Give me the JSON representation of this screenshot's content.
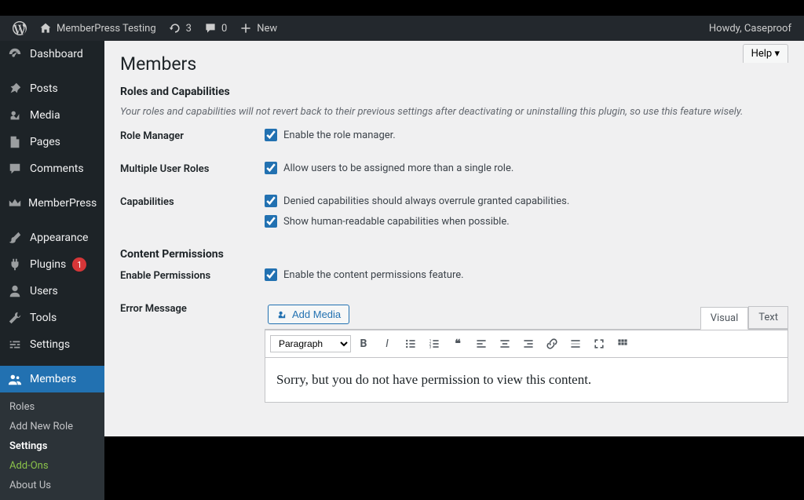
{
  "adminbar": {
    "site_title": "MemberPress Testing",
    "updates": "3",
    "comments": "0",
    "new": "New",
    "howdy": "Howdy, Caseproof"
  },
  "sidebar": {
    "items": [
      {
        "label": "Dashboard"
      },
      {
        "label": "Posts"
      },
      {
        "label": "Media"
      },
      {
        "label": "Pages"
      },
      {
        "label": "Comments"
      },
      {
        "label": "MemberPress"
      },
      {
        "label": "Appearance"
      },
      {
        "label": "Plugins",
        "badge": "1"
      },
      {
        "label": "Users"
      },
      {
        "label": "Tools"
      },
      {
        "label": "Settings"
      },
      {
        "label": "Members"
      }
    ],
    "submenu": [
      {
        "label": "Roles"
      },
      {
        "label": "Add New Role"
      },
      {
        "label": "Settings"
      },
      {
        "label": "Add-Ons"
      },
      {
        "label": "About Us"
      }
    ]
  },
  "page": {
    "help": "Help",
    "title": "Members",
    "section1_title": "Roles and Capabilities",
    "section1_desc": "Your roles and capabilities will not revert back to their previous settings after deactivating or uninstalling this plugin, so use this feature wisely.",
    "role_manager_label": "Role Manager",
    "role_manager_chk": "Enable the role manager.",
    "multi_roles_label": "Multiple User Roles",
    "multi_roles_chk": "Allow users to be assigned more than a single role.",
    "capabilities_label": "Capabilities",
    "capabilities_chk1": "Denied capabilities should always overrule granted capabilities.",
    "capabilities_chk2": "Show human-readable capabilities when possible.",
    "section2_title": "Content Permissions",
    "enable_perm_label": "Enable Permissions",
    "enable_perm_chk": "Enable the content permissions feature.",
    "error_msg_label": "Error Message",
    "add_media": "Add Media",
    "visual_tab": "Visual",
    "text_tab": "Text",
    "paragraph": "Paragraph",
    "editor_content": "Sorry, but you do not have permission to view this content."
  }
}
